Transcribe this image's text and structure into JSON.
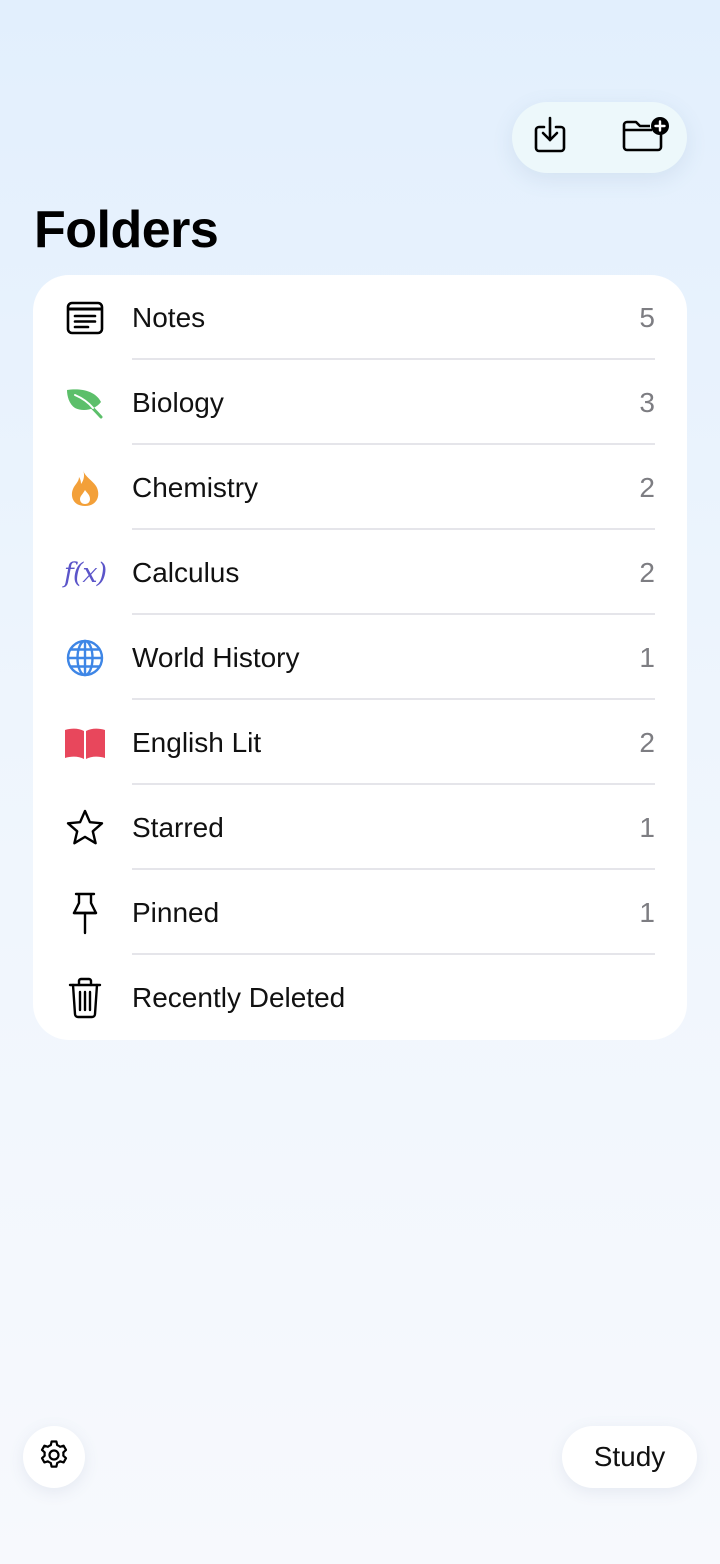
{
  "toolbar": {
    "import_icon": "tray-arrow-down-icon",
    "new_folder_icon": "folder-plus-icon"
  },
  "page": {
    "title": "Folders"
  },
  "folders": [
    {
      "label": "Notes",
      "count": "5",
      "icon": "note-text-icon"
    },
    {
      "label": "Biology",
      "count": "3",
      "icon": "leaf-icon",
      "color": "#5cbf6a"
    },
    {
      "label": "Chemistry",
      "count": "2",
      "icon": "flame-icon",
      "color": "#f3a039"
    },
    {
      "label": "Calculus",
      "count": "2",
      "icon": "function-icon",
      "glyph": "f(x)",
      "color": "#5b55c9"
    },
    {
      "label": "World History",
      "count": "1",
      "icon": "globe-icon",
      "color": "#3e86e6"
    },
    {
      "label": "English Lit",
      "count": "2",
      "icon": "book-icon",
      "color": "#e8475c"
    },
    {
      "label": "Starred",
      "count": "1",
      "icon": "star-icon"
    },
    {
      "label": "Pinned",
      "count": "1",
      "icon": "pin-icon"
    },
    {
      "label": "Recently Deleted",
      "count": "",
      "icon": "trash-icon"
    }
  ],
  "bottom": {
    "settings_icon": "gear-icon",
    "study_label": "Study"
  }
}
